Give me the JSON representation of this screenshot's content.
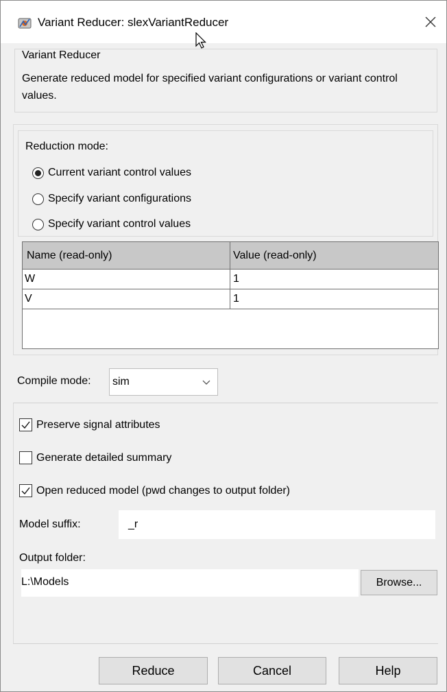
{
  "window": {
    "title": "Variant Reducer: slexVariantReducer",
    "app_icon": "matlab-simulink-icon",
    "close_icon": "close-icon"
  },
  "intro": {
    "title": "Variant Reducer",
    "description": "Generate reduced model for specified variant configurations or variant control values."
  },
  "reduction": {
    "label": "Reduction mode:",
    "options": [
      {
        "label": "Current variant control values",
        "checked": true
      },
      {
        "label": "Specify variant configurations",
        "checked": false
      },
      {
        "label": "Specify variant control values",
        "checked": false
      }
    ]
  },
  "table": {
    "headers": [
      "Name (read-only)",
      "Value (read-only)"
    ],
    "rows": [
      [
        "W",
        "1"
      ],
      [
        "V",
        "1"
      ]
    ]
  },
  "compile": {
    "label": "Compile mode:",
    "value": "sim"
  },
  "options": {
    "preserve": {
      "label": "Preserve signal attributes",
      "checked": true
    },
    "summary": {
      "label": "Generate detailed summary",
      "checked": false
    },
    "open_reduced": {
      "label": "Open reduced model (pwd changes to output folder)",
      "checked": true
    }
  },
  "model_suffix": {
    "label": "Model suffix:",
    "value": "_r"
  },
  "output_folder": {
    "label": "Output folder:",
    "value": "L:\\Models",
    "browse_label": "Browse..."
  },
  "buttons": {
    "reduce": "Reduce",
    "cancel": "Cancel",
    "help": "Help"
  }
}
